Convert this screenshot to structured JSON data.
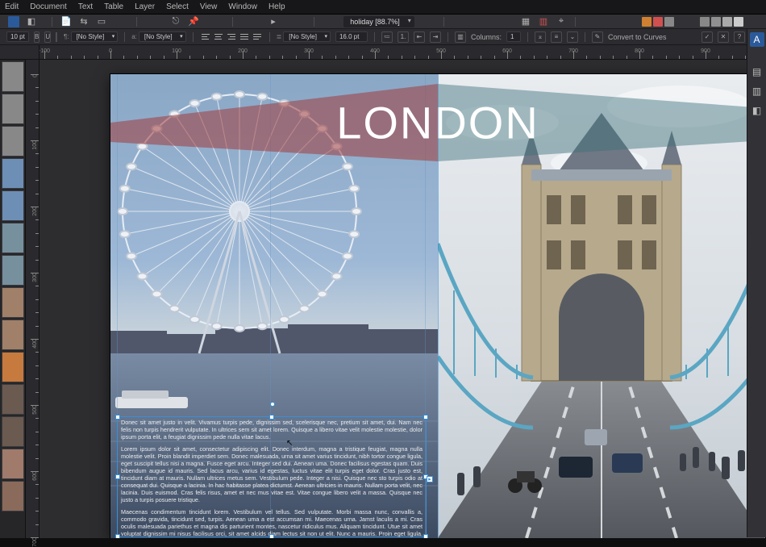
{
  "menu": {
    "items": [
      "Edit",
      "Document",
      "Text",
      "Table",
      "Layer",
      "Select",
      "View",
      "Window",
      "Help"
    ]
  },
  "document": {
    "name": "holiday",
    "zoom": "88.7%",
    "tab_label": "holiday [88.7%]"
  },
  "textbar": {
    "para_style_label": ":",
    "para_style": "[No Style]",
    "char_style_label": ":",
    "char_style": "[No Style]",
    "font_size": "10 pt",
    "leading_label": "",
    "leading": "[No Style]",
    "list_indent": "16.0 pt",
    "columns_label": "Columns:",
    "columns": "1",
    "convert_label": "Convert to Curves"
  },
  "artboard": {
    "title": "LONDON",
    "paragraphs": [
      "Donec sit amet justo in velit. Vivamus turpis pede, dignissim sed, scelerisque nec, pretium sit amet, dui. Nam nec felis non turpis hendrerit vulputate. In ultrices sem sit amet lorem. Quisque a libero vitae velit molestie molestie, dolor ipsum porta elit, a feugiat dignissim pede nulla vitae lacus.",
      "Lorem ipsum dolor sit amet, consectetur adipiscing elit. Donec interdum, magna a tristique feugiat, magna nulla molestie velit. Proin blandit imperdiet sem. Donec malesuada, urna sit amet varius tincidunt, nibh tortor congue ligula, eget suscipit tellus nisi a magna. Fusce eget arcu. Integer sed dui. Aenean uma. Donec facilisus egestas quam. Duis bibendum augue id mauris. Sed lacus arcu, varius id egestas, luctus vitae elit turpis eget dolor. Cras justo est, tincidunt diam at mauris. Nullam ultrices metus sem. Vestibulum pede. Integer a nisi. Quisque nec sto turpis odio at consequat dui. Quisque a lacinia. In hac habitasse platea dictumst. Aenean ultricies in mauris. Nullam porta velit, nec lacinia. Duis euismod. Cras felis risus, amet et nec mus vitae est. Vitae congue libero velit a massa. Quisque nec justo a turpis posuere tristique.",
      "Maecenas condimentum tincidunt lorem. Vestibulum vel tellus. Sed vulputate. Morbi massa nunc, convallis a, commodo gravida, tincidunt sed, turpis. Aenean uma a est accumsan mi. Maecenas urna. Jamst laculis a mi. Cras oculis malesuada pariethus et magna dis parturient montes, nascetur ridiculus mus. Aliquam tincidunt. Utue sit amet voluptat dignissim mi nisus facilisus orci, sit amet alcids diam lectus sit non ut elit. Nunc a mauris. Proin eget ligula. Nam cursus libero."
    ]
  },
  "ruler": {
    "h_start": -100,
    "h_step": 100,
    "h_count": 11,
    "v_start": 0,
    "v_step": 100,
    "v_count": 7
  },
  "colors": {
    "accent": "#2a5a9a",
    "banner_red": "#a03c3c",
    "banner_teal": "#3c6e7a"
  },
  "thumbnails": [
    "grayscale",
    "grayscale",
    "grayscale",
    "blue-sky",
    "blue-sky",
    "mountain",
    "mountain",
    "people",
    "people",
    "sunset",
    "crowd",
    "crowd",
    "woman",
    "hands"
  ],
  "icons": {
    "pointer": "pointer",
    "star": "star",
    "file": "file",
    "arrange": "arrange",
    "alignL": "align-left",
    "alignC": "align-center",
    "alignR": "align-right",
    "tab": "tab",
    "play": "play",
    "columns": "columns",
    "convert": "convert"
  }
}
